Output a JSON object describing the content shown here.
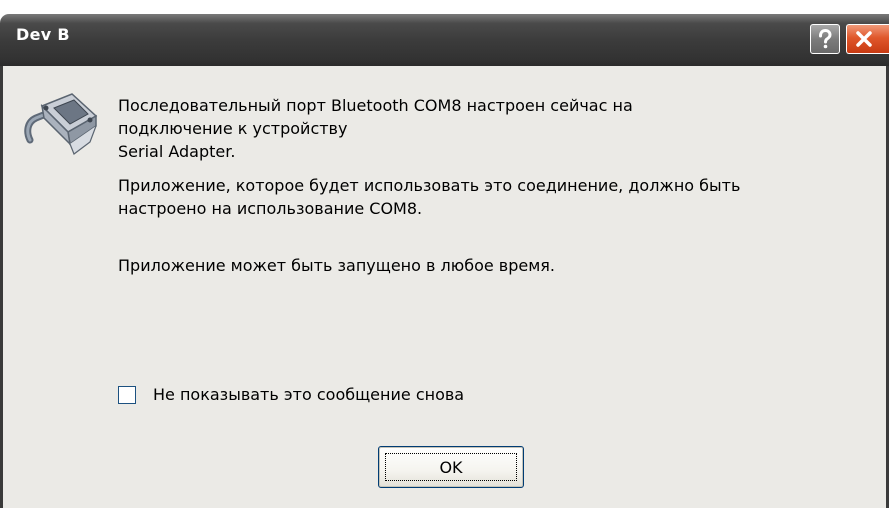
{
  "window": {
    "title": "Dev B",
    "help_icon": "question-mark",
    "close_icon": "x-close"
  },
  "message": {
    "icon": "serial-port-connector",
    "lines_block1": [
      "Последовательный порт Bluetooth COM8 настроен сейчас на",
      "подключение к устройству",
      "Serial Adapter."
    ],
    "lines_block2": [
      "Приложение, которое будет использовать это соединение, должно быть",
      "настроено на использование COM8."
    ],
    "line_block3": "Приложение может быть запущено в любое время."
  },
  "checkbox": {
    "label": "Не показывать это сообщение снова",
    "checked": false
  },
  "buttons": {
    "ok_label": "OK"
  },
  "colors": {
    "titlebar": "#3c3c3c",
    "client_bg": "#ebeae6",
    "close_button": "#e0582c",
    "button_border": "#003c74"
  }
}
